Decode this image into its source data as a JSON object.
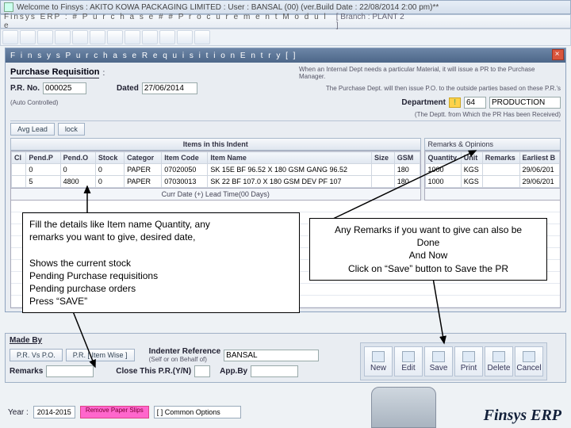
{
  "window": {
    "main_title": "Welcome to Finsys : AKITO KOWA PACKAGING LIMITED : User : BANSAL (00) (ver.Build Date : 22/08/2014 2:00 pm)**",
    "module_title": "Finsys ERP  :  # P u r c h a s e  # #  P r o c u r e m e n t   M o d u l e",
    "branch": "[ Branch : PLANT 2 ]",
    "entry_title": "F i n s y s   P u r c h a s e   R e q u i s i t i o n   E n t r y  [ ]"
  },
  "header": {
    "pr_label": "Purchase Requisition",
    "colon": ":",
    "prno_lbl": "P.R. No.",
    "prno_val": "000025",
    "dated_lbl": "Dated",
    "dated_val": "27/06/2014",
    "auto_note": "(Auto Controlled)",
    "help1": "When an Internal Dept needs a particular Material, it will issue a PR to the Purchase Manager.",
    "help2": "The Purchase Dept. will then issue P.O. to the outside parties based on these P.R.'s",
    "dept_lbl": "Department",
    "dept_code": "64",
    "dept_name": "PRODUCTION",
    "dept_note": "(The Deptt. from Which the PR Has been Received)"
  },
  "tabs": {
    "avg": "Avg Lead",
    "lock": "lock"
  },
  "items_section": {
    "title": "Items in this Indent",
    "remarks_title": "Remarks & Opinions",
    "cols": {
      "cl": "Cl",
      "pendp": "Pend.P",
      "pendo": "Pend.O",
      "stock": "Stock",
      "categ": "Categor",
      "code": "Item Code",
      "name": "Item Name",
      "size": "Size",
      "gsm": "GSM",
      "qty": "Quantity",
      "unit": "Unit",
      "rem": "Remarks",
      "earl": "Earliest B"
    },
    "rows": [
      {
        "cl": "",
        "pendp": "0",
        "pendo": "0",
        "stock": "0",
        "categ": "PAPER",
        "code": "07020050",
        "name": "SK 15E BF  96.52 X 180 GSM  GANG  96.52",
        "size": "",
        "gsm": "180",
        "qty": "1000",
        "unit": "KGS",
        "rem": "",
        "earl": "29/06/201"
      },
      {
        "cl": "",
        "pendp": "5",
        "pendo": "4800",
        "stock": "0",
        "categ": "PAPER",
        "code": "07030013",
        "name": "SK 22 BF 107.0 X 180 GSM  DEV PF  107",
        "size": "",
        "gsm": "180",
        "qty": "1000",
        "unit": "KGS",
        "rem": "",
        "earl": "29/06/201"
      }
    ],
    "lead_note": "Curr Date (+) Lead Time(00 Days)"
  },
  "bottom": {
    "made_by": "Made By",
    "prvspo": "P.R. Vs P.O.",
    "itemwise": "P.R. [ Item Wise ]",
    "indenter_lbl": "Indenter Reference",
    "indenter_sub": "(Self or on Behalf of)",
    "indenter_val": "BANSAL",
    "remark_lbl": "Remarks",
    "close_lbl": "Close This P.R.(Y/N)",
    "appby_lbl": "App.By"
  },
  "actions": {
    "new": "New",
    "edit": "Edit",
    "save": "Save",
    "print": "Print",
    "delete": "Delete",
    "cancel": "Cancel"
  },
  "footer": {
    "year_lbl": "Year :",
    "year": "2014-2015",
    "pink": "Remove Paper Slips",
    "combo": "[ ] Common Options"
  },
  "brand": "Finsys ERP",
  "annotations": {
    "left": {
      "l1": "Fill the details like Item name Quantity, any",
      "l2": "remarks you want to give, desired date,",
      "l3": "Shows the current stock",
      "l4": "Pending Purchase requisitions",
      "l5": "Pending purchase orders",
      "l6": "Press “SAVE”"
    },
    "right": {
      "l1": "Any Remarks if you want to give can also be",
      "l2": "Done",
      "l3": "And Now",
      "l4": "Click on “Save” button to Save the PR"
    }
  }
}
